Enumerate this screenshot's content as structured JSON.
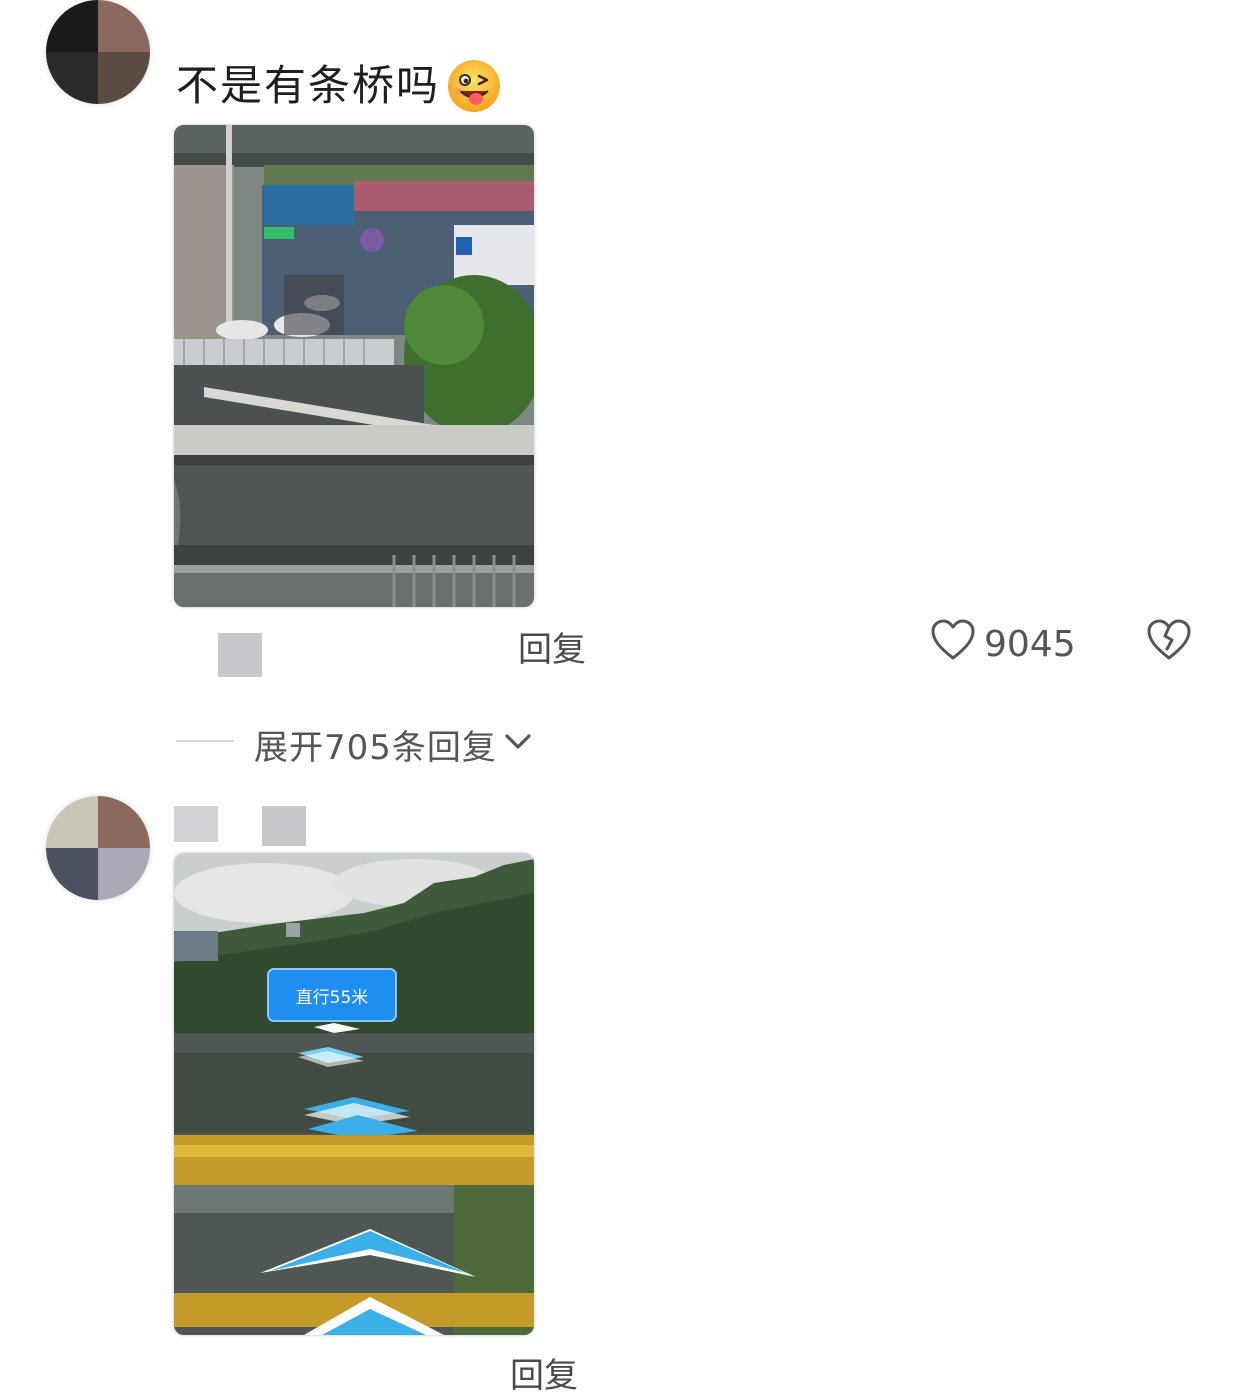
{
  "comments": [
    {
      "text": "不是有条桥吗",
      "emoji_icon": "winking-tongue-face-icon",
      "reply_label": "回复",
      "like_count": "9045",
      "like_icon": "heart-outline-icon",
      "dislike_icon": "broken-heart-icon",
      "expand_label": "展开705条回复",
      "expand_icon": "chevron-down-icon"
    },
    {
      "text": "",
      "photo_overlay": {
        "nav_label": "直行55米",
        "nav_color": "#1f8ef1"
      },
      "reply_label": "回复"
    }
  ],
  "colors": {
    "text": "#1e1e1e",
    "secondary": "#555555",
    "nav_arrow": "#3bb0e8"
  }
}
